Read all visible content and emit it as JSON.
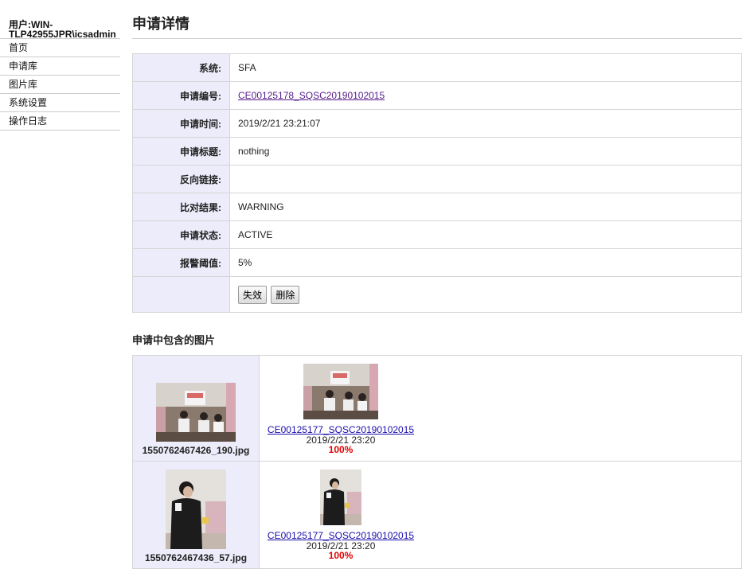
{
  "sidebar": {
    "user_label": "用户:WIN-\nTLP42955JPR\\icsadmin",
    "nav": [
      "首页",
      "申请库",
      "图片库",
      "系统设置",
      "操作日志"
    ]
  },
  "page": {
    "title": "申请详情"
  },
  "detail": {
    "rows": [
      {
        "key": "系统:",
        "value": "SFA"
      },
      {
        "key": "申请编号:",
        "value": "CE00125178_SQSC20190102015"
      },
      {
        "key": "申请时间:",
        "value": "2019/2/21 23:21:07"
      },
      {
        "key": "申请标题:",
        "value": "nothing"
      },
      {
        "key": "反向链接:",
        "value": ""
      },
      {
        "key": "比对结果:",
        "value": "WARNING"
      },
      {
        "key": "申请状态:",
        "value": "ACTIVE"
      },
      {
        "key": "报警阈值:",
        "value": "5%"
      }
    ],
    "buttons": {
      "invalidate": "失效",
      "delete": "删除"
    }
  },
  "images_section": {
    "title": "申请中包含的图片",
    "items": [
      {
        "filename": "1550762467426_190.jpg",
        "match": {
          "link": "CE00125177_SQSC20190102015",
          "time": "2019/2/21 23:20",
          "percent": "100%"
        }
      },
      {
        "filename": "1550762467436_57.jpg",
        "match": {
          "link": "CE00125177_SQSC20190102015",
          "time": "2019/2/21 23:20",
          "percent": "100%"
        }
      }
    ]
  },
  "colors": {
    "percent": "#e00000",
    "key_bg": "#ececfb",
    "link": "#551a8b"
  }
}
